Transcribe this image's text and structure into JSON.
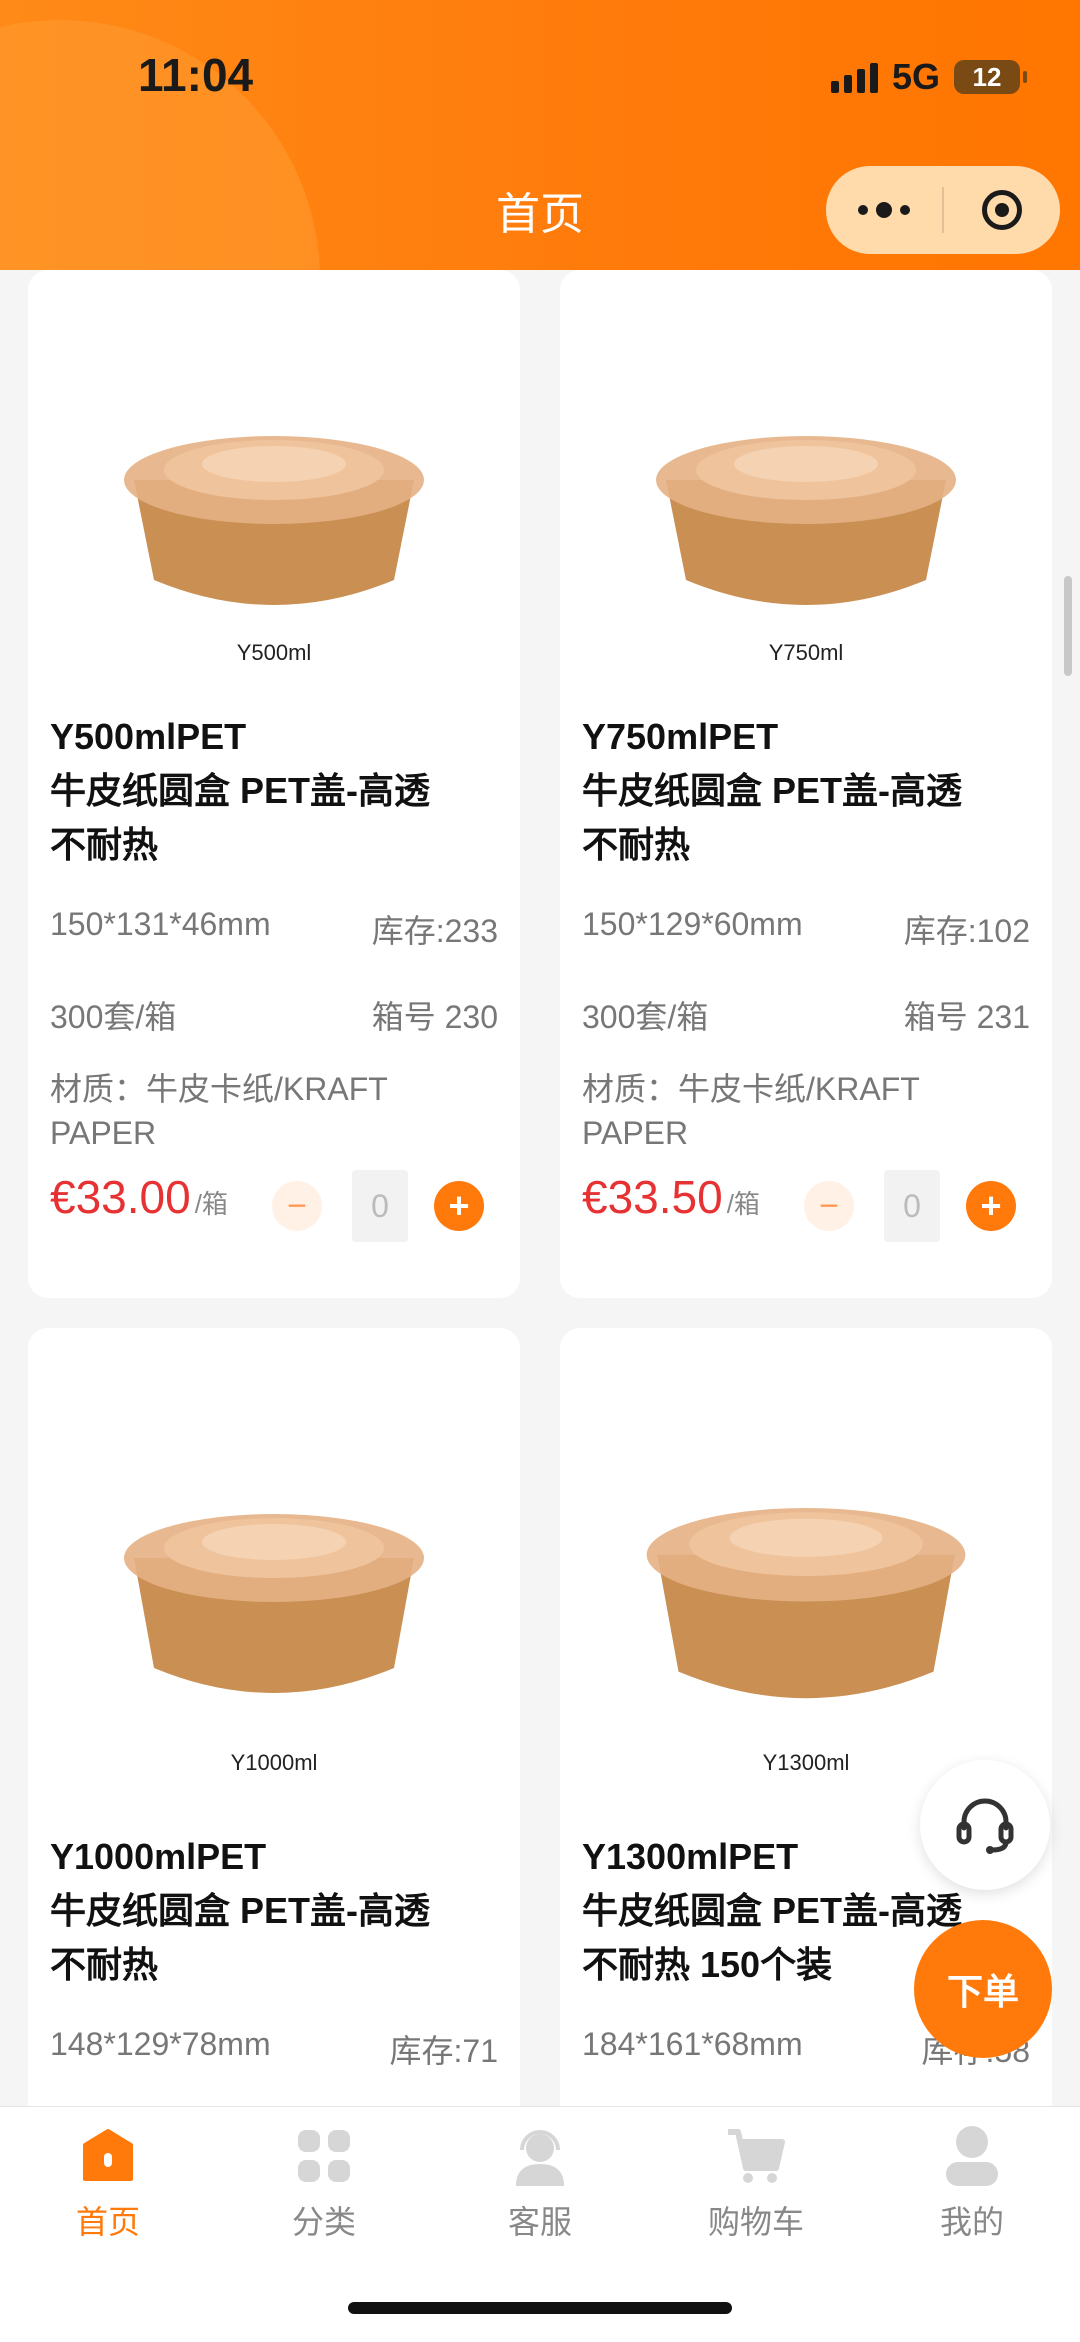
{
  "status": {
    "time": "11:04",
    "network": "5G",
    "battery": "12"
  },
  "header": {
    "title": "首页"
  },
  "colors": {
    "brand": "#ff7a0a",
    "price": "#e63232"
  },
  "products": [
    {
      "image_label": "Y500ml",
      "title_line1": "Y500mlPET",
      "title_line2": "牛皮纸圆盒 PET盖-高透",
      "title_line3": "不耐热",
      "size": "150*131*46mm",
      "stock": "库存:233",
      "pack": "300套/箱",
      "box_no": "箱号 230",
      "material_line1": "材质：牛皮卡纸/KRAFT",
      "material_line2": "PAPER",
      "price": "€33.00",
      "unit": "/箱",
      "qty": "0"
    },
    {
      "image_label": "Y750ml",
      "title_line1": "Y750mlPET",
      "title_line2": "牛皮纸圆盒 PET盖-高透",
      "title_line3": "不耐热",
      "size": "150*129*60mm",
      "stock": "库存:102",
      "pack": "300套/箱",
      "box_no": "箱号 231",
      "material_line1": "材质：牛皮卡纸/KRAFT",
      "material_line2": "PAPER",
      "price": "€33.50",
      "unit": "/箱",
      "qty": "0"
    },
    {
      "image_label": "Y1000ml",
      "title_line1": "Y1000mlPET",
      "title_line2": "牛皮纸圆盒 PET盖-高透",
      "title_line3": "不耐热",
      "size": "148*129*78mm",
      "stock": "库存:71"
    },
    {
      "image_label": "Y1300ml",
      "title_line1": "Y1300mlPET",
      "title_line2": "牛皮纸圆盒 PET盖-高透",
      "title_line3": "不耐热 150个装",
      "size": "184*161*68mm",
      "stock": "库存:58"
    }
  ],
  "floating": {
    "order_label": "下单",
    "support_icon": "headset-icon"
  },
  "tabs": [
    {
      "label": "首页",
      "icon": "home-icon",
      "active": true
    },
    {
      "label": "分类",
      "icon": "grid-icon",
      "active": false
    },
    {
      "label": "客服",
      "icon": "headset-person-icon",
      "active": false
    },
    {
      "label": "购物车",
      "icon": "cart-icon",
      "active": false
    },
    {
      "label": "我的",
      "icon": "user-icon",
      "active": false
    }
  ]
}
